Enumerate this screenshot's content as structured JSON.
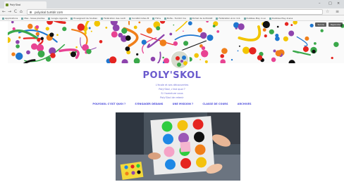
{
  "browser": {
    "tab_title": "Poly'Skol",
    "url": "polyskol.tumblr.com",
    "nav_back": "←",
    "nav_forward": "→",
    "nav_reload": "C",
    "nav_home": "⌂",
    "bookmarks": [
      "Applications",
      "Mes - taxes plantes",
      "Google Agenda",
      "Enseignant de Soutien",
      "Fédération des centr",
      "Société Cotes M",
      "Films",
      "Boîte - Tumblr ma",
      "Portail de la Mobilit",
      "Fédération écol. Cré",
      "Dubbles Play in so",
      "Dubbles Play Arena"
    ],
    "window_controls": [
      "–",
      "□",
      "×"
    ]
  },
  "banner": {
    "buttons": [
      "Suivre",
      "Rejoindre"
    ],
    "colors": [
      "#e52521",
      "#1f77d0",
      "#f2c500",
      "#3aa84a",
      "#8e44ad",
      "#f07f1a",
      "#111111",
      "#e84393"
    ]
  },
  "blog": {
    "title": "POLY'SKOL",
    "description_lines": [
      "L'école et ses découvertes",
      "Poly'Skol, c'est quoi ?",
      "Si l'aventure vous",
      "Poly'Skol de retenir"
    ],
    "nav": [
      "POLYSKOL C'EST QUOI ?",
      "S'ENGAGER DEDANS",
      "UNE MISSION ?",
      "CLASSE DE COURS",
      "ARCHIVES"
    ]
  },
  "photo": {
    "dot_colors": [
      "#2ecc40",
      "#f4c20d",
      "#e52521",
      "#1e88e5",
      "#9b59b6",
      "#111111",
      "#f5a3c7",
      "#2ecc40",
      "#f07f1a",
      "#1e88e5",
      "#e52521",
      "#f4c20d"
    ]
  }
}
